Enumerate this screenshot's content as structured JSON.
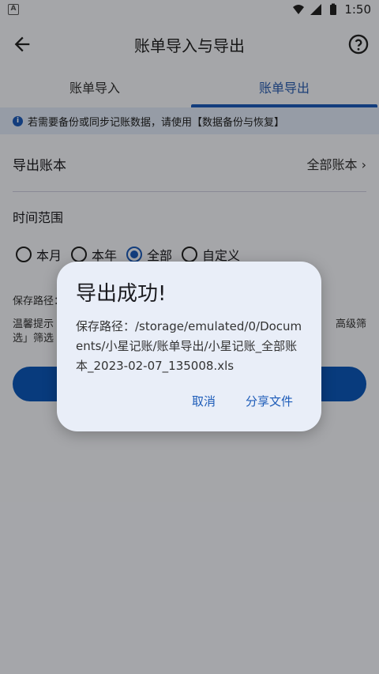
{
  "status_bar": {
    "time": "1:50"
  },
  "app_bar": {
    "title": "账单导入与导出"
  },
  "tabs": [
    {
      "label": "账单导入"
    },
    {
      "label": "账单导出"
    }
  ],
  "notice": {
    "text": "若需要备份或同步记账数据，请使用【数据备份与恢复】"
  },
  "export_book": {
    "label": "导出账本",
    "value": "全部账本",
    "chevron": "›"
  },
  "time_range": {
    "label": "时间范围",
    "options": [
      "本月",
      "本年",
      "全部",
      "自定义"
    ],
    "selected": "全部"
  },
  "background": {
    "save_path_label": "保存路径：",
    "tip_line1": "温馨提示",
    "tip_line1_right": "高级筛",
    "tip_line2": "选」筛选"
  },
  "dialog": {
    "title": "导出成功!",
    "message": "保存路径：/storage/emulated/0/Documents/小星记账/账单导出/小星记账_全部账本_2023-02-07_135008.xls",
    "cancel": "取消",
    "share": "分享文件"
  },
  "colors": {
    "accent": "#1c5bb8",
    "notice_bg": "#dde6f5",
    "dialog_bg": "#e9eef8"
  }
}
